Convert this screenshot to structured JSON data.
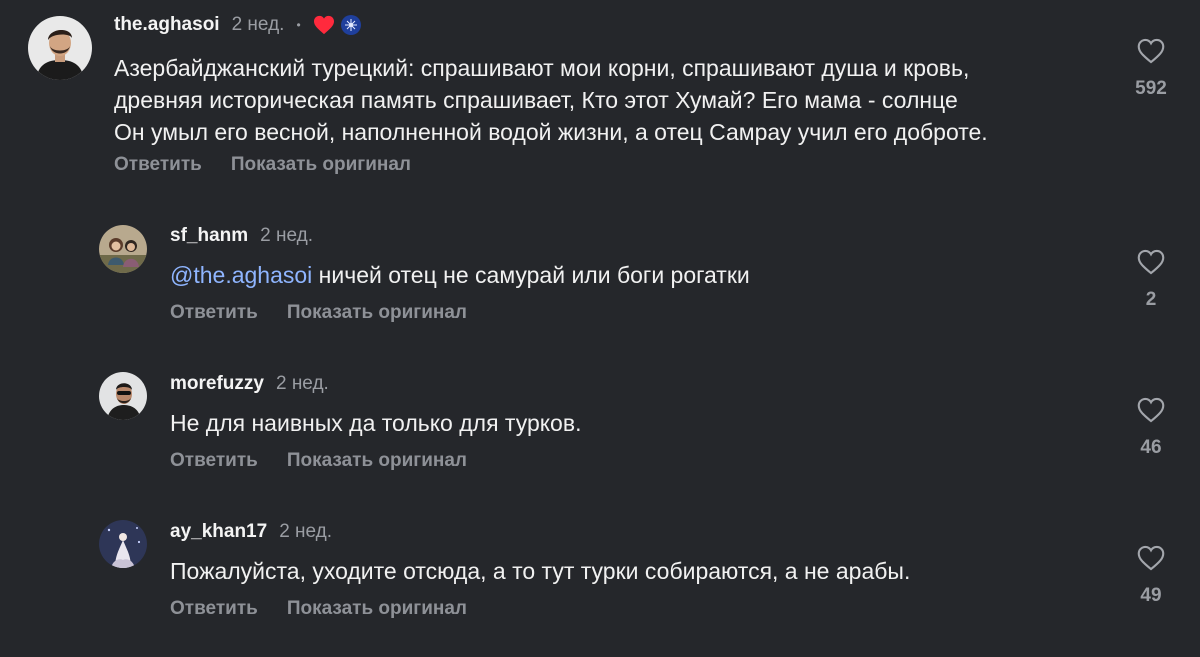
{
  "comments": [
    {
      "username": "the.aghasoi",
      "time": "2 нед.",
      "separator": "•",
      "badges": [
        "liked-by-creator-heart-icon",
        "creator-avatar-badge-icon"
      ],
      "text_lines": [
        "Азербайджанский турецкий: спрашивают мои корни, спрашивают душа и кровь,",
        "древняя историческая память спрашивает, Кто этот Хумай? Его мама - солнце",
        "Он умыл его весной, наполненной водой жизни, а отец Самрау учил его доброте."
      ],
      "reply_label": "Ответить",
      "show_original_label": "Показать оригинал",
      "likes": "592"
    },
    {
      "username": "sf_hanm",
      "time": "2 нед.",
      "mention": "@the.aghasoi",
      "text": " ничей отец не самурай или боги рогатки",
      "reply_label": "Ответить",
      "show_original_label": "Показать оригинал",
      "likes": "2"
    },
    {
      "username": "morefuzzy",
      "time": "2 нед.",
      "text": "Не для наивных да только для турков.",
      "reply_label": "Ответить",
      "show_original_label": "Показать оригинал",
      "likes": "46"
    },
    {
      "username": "ay_khan17",
      "time": "2 нед.",
      "text": "Пожалуйста, уходите отсюда, а то тут турки собираются, а не арабы.",
      "reply_label": "Ответить",
      "show_original_label": "Показать оригинал",
      "likes": "49"
    }
  ],
  "colors": {
    "background": "#25272b",
    "primary_text": "#f1f1f1",
    "secondary_text": "#9a9da3",
    "mention": "#8fb5ff",
    "heart_badge": "#ff2a3d"
  }
}
